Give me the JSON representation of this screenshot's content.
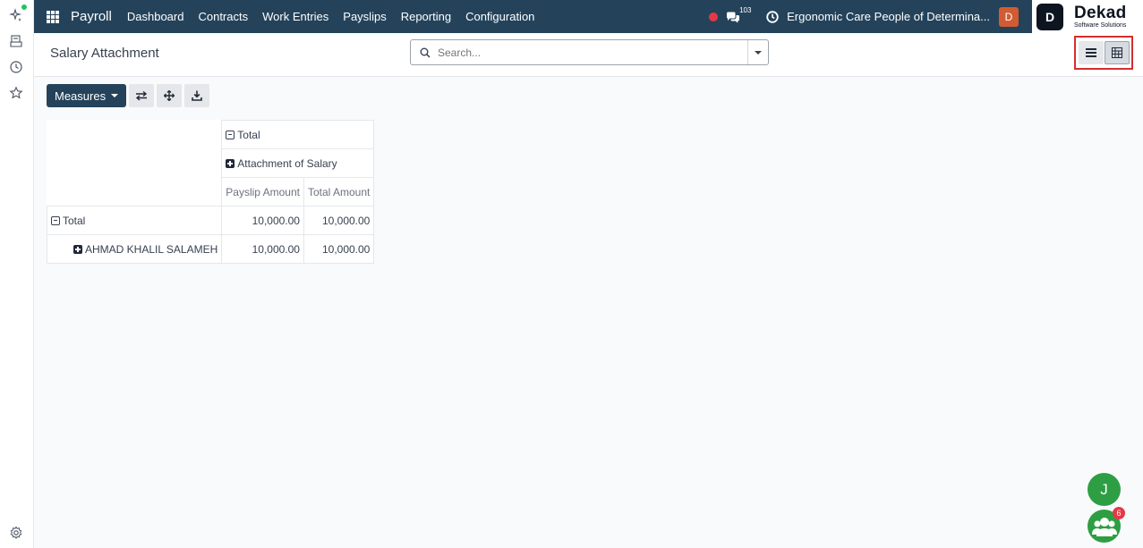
{
  "navbar": {
    "app_name": "Payroll",
    "menu": [
      "Dashboard",
      "Contracts",
      "Work Entries",
      "Payslips",
      "Reporting",
      "Configuration"
    ],
    "messages_count": "103",
    "company": "Ergonomic Care People of Determina...",
    "user_initial": "D"
  },
  "logo": {
    "mark": "D",
    "name": "Dekad",
    "tagline": "Software Solutions"
  },
  "control_panel": {
    "title": "Salary Attachment",
    "search_placeholder": "Search..."
  },
  "toolbar": {
    "measures_label": "Measures"
  },
  "pivot": {
    "col_total_label": "Total",
    "col_group_label": "Attachment of Salary",
    "measures": [
      "Payslip Amount",
      "Total Amount"
    ],
    "rows": [
      {
        "label": "Total",
        "expanded": true,
        "values": [
          "10,000.00",
          "10,000.00"
        ]
      },
      {
        "label": "AHMAD KHALIL SALAMEH",
        "expanded": false,
        "values": [
          "10,000.00",
          "10,000.00"
        ]
      }
    ]
  },
  "floating": {
    "user_initial": "J",
    "group_badge": "6"
  },
  "colors": {
    "navbar": "#24435b",
    "primary_button": "#24435b",
    "highlight_border": "#d32f2f",
    "fab": "#2e9e44",
    "badge": "#e53945",
    "avatar": "#d25b33"
  }
}
